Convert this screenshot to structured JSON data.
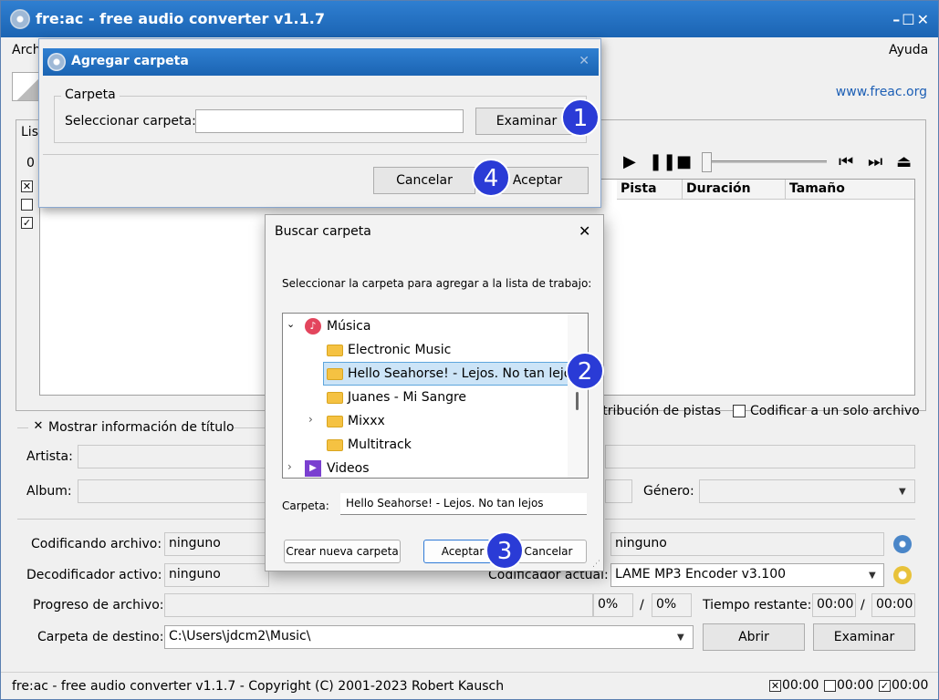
{
  "window": {
    "title": "fre:ac - free audio converter v1.1.7",
    "controls": "–☐✕"
  },
  "menu": {
    "archivo": "Arch",
    "ayuda": "Ayuda"
  },
  "toolbar": {
    "website": "www.freac.org"
  },
  "tabs": {
    "joblist_partial": "List"
  },
  "joblist": {
    "count_partial": "0 a",
    "columns": [
      "Pista",
      "Duración",
      "Tamaño"
    ],
    "options": {
      "distribution_partial": "stribución de pistas",
      "single_file": "Codificar a un solo archivo"
    }
  },
  "title_info": {
    "show_label": "Mostrar información de título",
    "artist_label": "Artista:",
    "album_label": "Album:",
    "genre_label": "Género:"
  },
  "status": {
    "encoding_file_label": "Codificando archivo:",
    "encoding_file_value": "ninguno",
    "encoding_file_value2": "ninguno",
    "decoder_label": "Decodificador activo:",
    "decoder_value": "ninguno",
    "encoder_label": "Codificador actual:",
    "encoder_value": "LAME MP3 Encoder v3.100",
    "file_progress_label": "Progreso de archivo:",
    "progress_pct1": "0%",
    "progress_sep": "/",
    "progress_pct2": "0%",
    "time_left_label": "Tiempo restante:",
    "time1": "00:00",
    "time_sep": "/",
    "time2": "00:00",
    "dest_label": "Carpeta de destino:",
    "dest_value": "C:\\Users\\jdcm2\\Music\\",
    "open_button": "Abrir",
    "browse_button": "Examinar"
  },
  "statusbar": {
    "copyright": "fre:ac - free audio converter v1.1.7 - Copyright (C) 2001-2023 Robert Kausch",
    "t1": "00:00",
    "t2": "00:00",
    "t3": "00:00"
  },
  "dialog_add_folder": {
    "title": "Agregar carpeta",
    "close": "✕",
    "group_title": "Carpeta",
    "select_label": "Seleccionar carpeta:",
    "select_value": "",
    "browse_button": "Examinar",
    "cancel_button": "Cancelar",
    "accept_button": "Aceptar"
  },
  "dialog_browse": {
    "title": "Buscar carpeta",
    "close": "✕",
    "instruction": "Seleccionar la carpeta para agregar a la lista de trabajo:",
    "tree": [
      {
        "label": "Música",
        "icon": "music-icon",
        "expander": "expanded"
      },
      {
        "label": "Electronic Music",
        "icon": "folder-icon",
        "expander": "none"
      },
      {
        "label": "Hello Seahorse! - Lejos. No tan lejos",
        "icon": "folder-icon",
        "expander": "none",
        "selected": true
      },
      {
        "label": "Juanes - Mi Sangre",
        "icon": "folder-icon",
        "expander": "none"
      },
      {
        "label": "Mixxx",
        "icon": "folder-icon",
        "expander": "collapsed"
      },
      {
        "label": "Multitrack",
        "icon": "folder-icon",
        "expander": "none"
      },
      {
        "label": "Videos",
        "icon": "video-icon",
        "expander": "collapsed"
      }
    ],
    "folder_label": "Carpeta:",
    "folder_value": "Hello Seahorse! - Lejos. No tan lejos",
    "new_folder_button": "Crear nueva carpeta",
    "accept_button": "Aceptar",
    "cancel_button": "Cancelar"
  },
  "badges": [
    "1",
    "2",
    "3",
    "4"
  ],
  "colors": {
    "titlebar": "#1b64b3",
    "badge": "#2a3bd6",
    "link": "#1d5fb5",
    "selection": "#cce4f7"
  }
}
